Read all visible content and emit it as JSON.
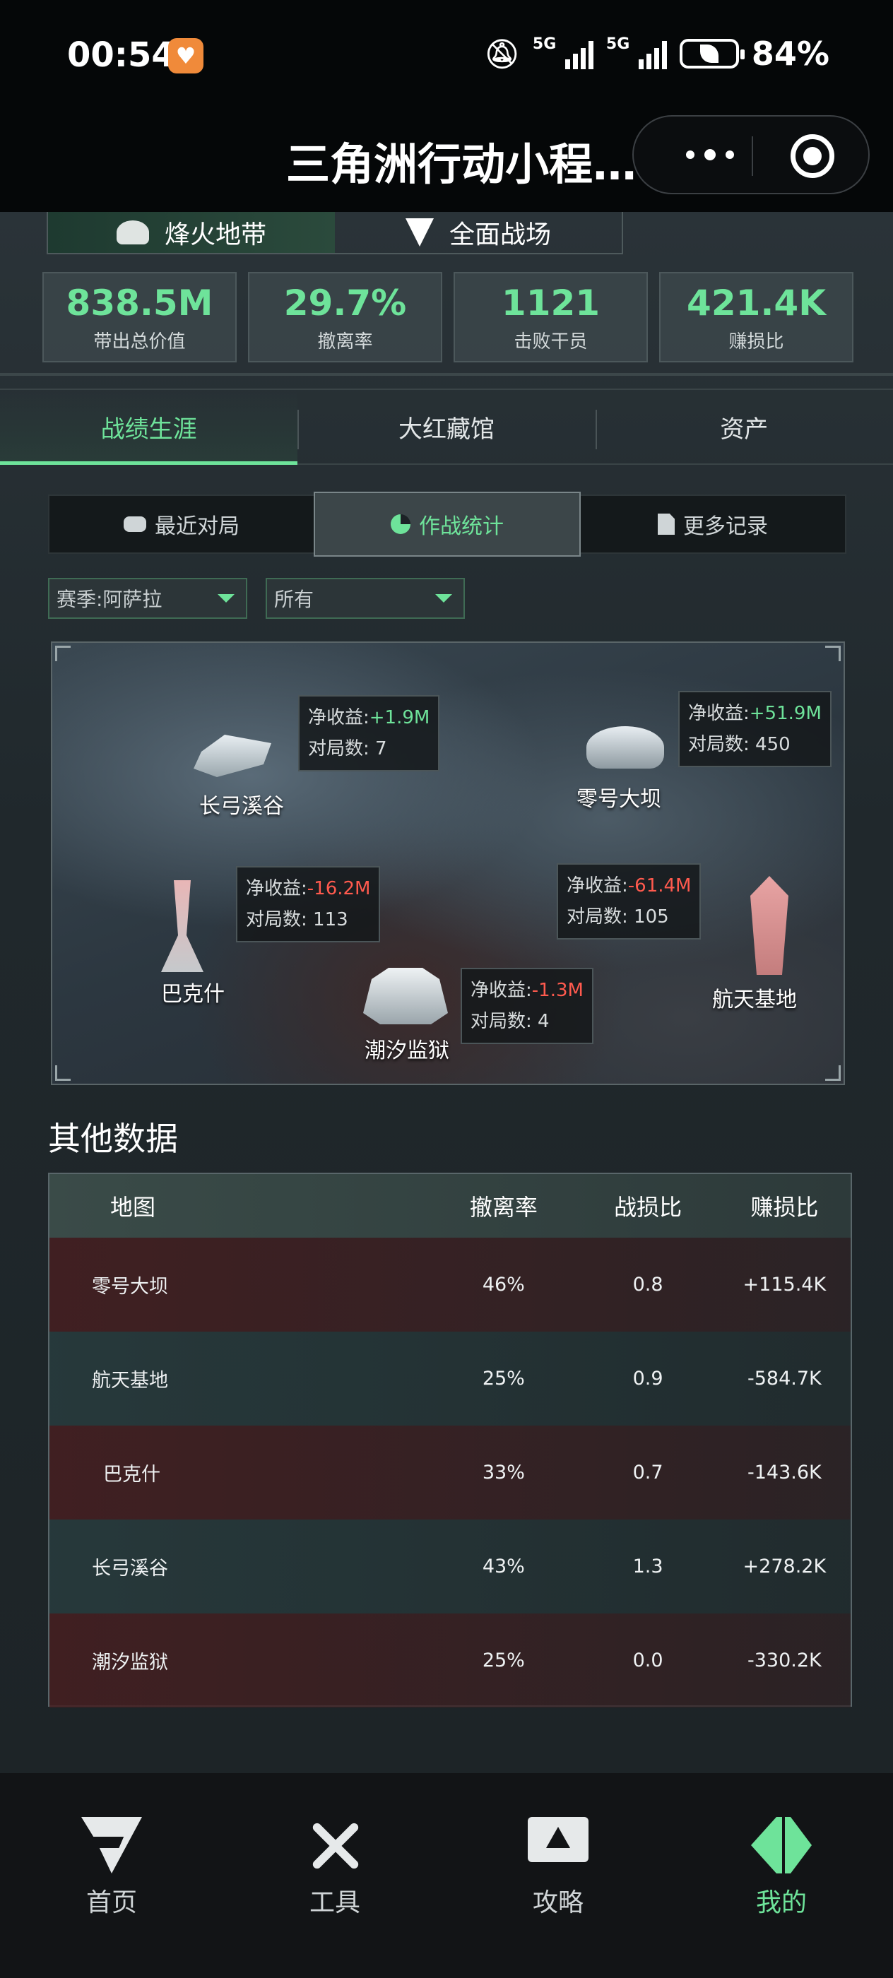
{
  "status_bar": {
    "time": "00:54",
    "network": "5G",
    "battery": "84%"
  },
  "title_bar": {
    "title": "三角洲行动小程…"
  },
  "mode_tabs": [
    {
      "label": "烽火地带",
      "active": true
    },
    {
      "label": "全面战场",
      "active": false
    }
  ],
  "stats": [
    {
      "value": "838.5M",
      "label": "带出总价值"
    },
    {
      "value": "29.7%",
      "label": "撤离率"
    },
    {
      "value": "1121",
      "label": "击败干员"
    },
    {
      "value": "421.4K",
      "label": "赚损比"
    }
  ],
  "career_tabs": [
    {
      "label": "战绩生涯",
      "active": true
    },
    {
      "label": "大红藏馆",
      "active": false
    },
    {
      "label": "资产",
      "active": false
    }
  ],
  "sub_tabs": [
    {
      "label": "最近对局",
      "icon": "gamepad-icon",
      "active": false
    },
    {
      "label": "作战统计",
      "icon": "pie-chart-icon",
      "active": true
    },
    {
      "label": "更多记录",
      "icon": "document-icon",
      "active": false
    }
  ],
  "filters": {
    "season": "赛季:阿萨拉",
    "scope": "所有"
  },
  "map_points": [
    {
      "name": "长弓溪谷",
      "net_label": "净收益:",
      "net": "+1.9M",
      "sign": "pos",
      "count_label": "对局数:",
      "count": "7"
    },
    {
      "name": "零号大坝",
      "net_label": "净收益:",
      "net": "+51.9M",
      "sign": "pos",
      "count_label": "对局数:",
      "count": "450"
    },
    {
      "name": "巴克什",
      "net_label": "净收益:",
      "net": "-16.2M",
      "sign": "neg",
      "count_label": "对局数:",
      "count": "113"
    },
    {
      "name": "航天基地",
      "net_label": "净收益:",
      "net": "-61.4M",
      "sign": "neg",
      "count_label": "对局数:",
      "count": "105"
    },
    {
      "name": "潮汐监狱",
      "net_label": "净收益:",
      "net": "-1.3M",
      "sign": "neg",
      "count_label": "对局数:",
      "count": "4"
    }
  ],
  "other_data": {
    "title": "其他数据",
    "headers": [
      "地图",
      "撤离率",
      "战损比",
      "赚损比"
    ],
    "rows": [
      {
        "map": "零号大坝",
        "extract": "46%",
        "kd": "0.8",
        "profit": "+115.4K"
      },
      {
        "map": "航天基地",
        "extract": "25%",
        "kd": "0.9",
        "profit": "-584.7K"
      },
      {
        "map": "巴克什",
        "extract": "33%",
        "kd": "0.7",
        "profit": "-143.6K"
      },
      {
        "map": "长弓溪谷",
        "extract": "43%",
        "kd": "1.3",
        "profit": "+278.2K"
      },
      {
        "map": "潮汐监狱",
        "extract": "25%",
        "kd": "0.0",
        "profit": "-330.2K"
      }
    ]
  },
  "bottom_nav": [
    {
      "label": "首页",
      "icon": "home-logo-icon",
      "active": false
    },
    {
      "label": "工具",
      "icon": "tools-icon",
      "active": false
    },
    {
      "label": "攻略",
      "icon": "guide-monitor-icon",
      "active": false
    },
    {
      "label": "我的",
      "icon": "profile-logo-icon",
      "active": true
    }
  ],
  "colors": {
    "accent": "#6ee39a",
    "negative": "#ff5a4e",
    "background": "#1c2226"
  }
}
